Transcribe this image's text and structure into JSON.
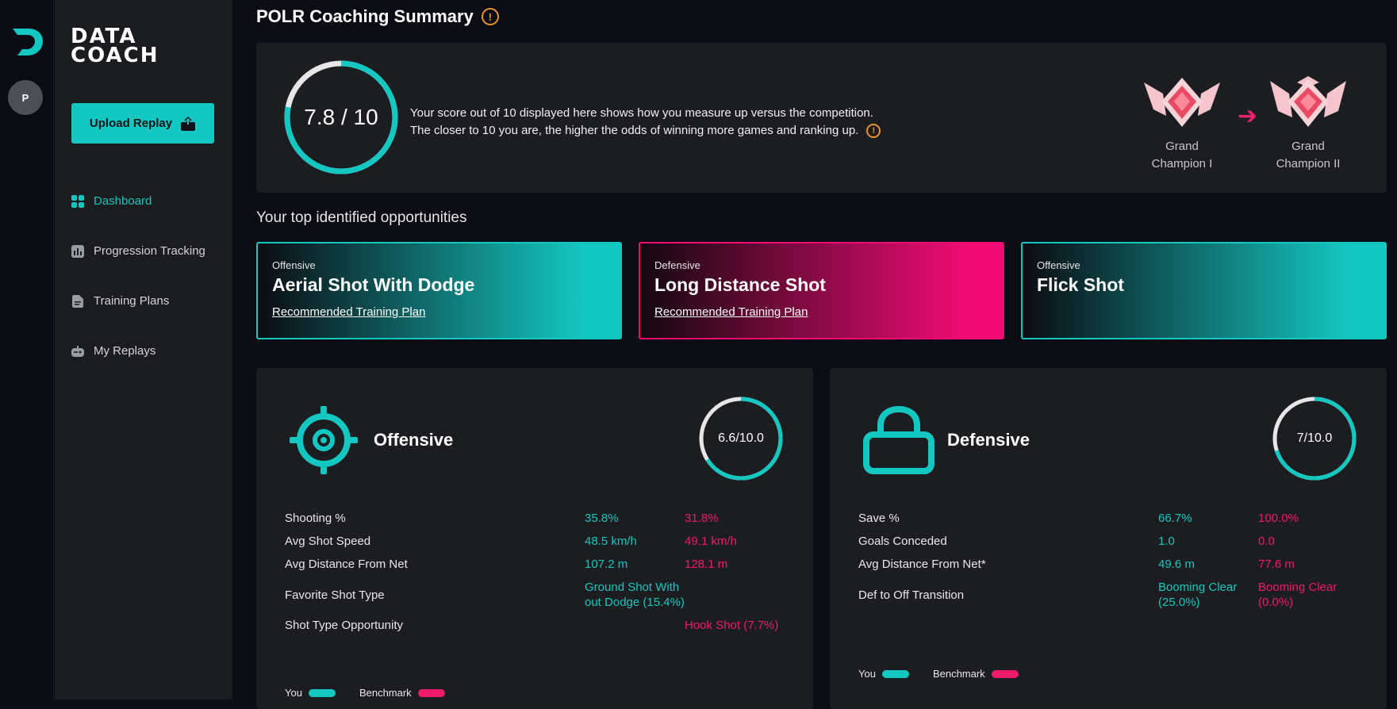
{
  "app": {
    "brand_line1": "DATA",
    "brand_line2": "COACH",
    "avatar_initial": "P"
  },
  "sidebar": {
    "upload_label": "Upload Replay",
    "items": [
      {
        "label": "Dashboard",
        "icon": "grid-icon",
        "active": true
      },
      {
        "label": "Progression Tracking",
        "icon": "bar-chart-icon",
        "active": false
      },
      {
        "label": "Training Plans",
        "icon": "document-icon",
        "active": false
      },
      {
        "label": "My Replays",
        "icon": "controller-icon",
        "active": false
      }
    ]
  },
  "summary": {
    "title": "POLR Coaching Summary",
    "score_text": "7.8 / 10",
    "score_value": 7.8,
    "score_max": 10,
    "desc_line1": "Your score out of 10 displayed here shows how you measure up versus the competition.",
    "desc_line2": "The closer to 10 you are, the higher the odds of winning more games and ranking up.",
    "rank_current_line1": "Grand",
    "rank_current_line2": "Champion I",
    "rank_next_line1": "Grand",
    "rank_next_line2": "Champion II",
    "arrow": "➔"
  },
  "opportunities": {
    "title": "Your top identified opportunities",
    "cards": [
      {
        "category": "Offensive",
        "name": "Aerial Shot With Dodge",
        "link": "Recommended Training Plan",
        "style": "teal"
      },
      {
        "category": "Defensive",
        "name": "Long Distance Shot",
        "link": "Recommended Training Plan",
        "style": "pink"
      },
      {
        "category": "Offensive",
        "name": "Flick Shot",
        "link": "",
        "style": "teal"
      }
    ]
  },
  "offensive": {
    "title": "Offensive",
    "score_text": "6.6/10.0",
    "score_value": 6.6,
    "score_max": 10,
    "rows": [
      {
        "label": "Shooting %",
        "you": "35.8%",
        "bench": "31.8%"
      },
      {
        "label": "Avg Shot Speed",
        "you": "48.5 km/h",
        "bench": "49.1 km/h"
      },
      {
        "label": "Avg Distance From Net",
        "you": "107.2 m",
        "bench": "128.1 m"
      },
      {
        "label": "Favorite Shot Type",
        "you": "Ground Shot With out Dodge (15.4%)",
        "bench": ""
      },
      {
        "label": "Shot Type Opportunity",
        "you": "",
        "bench": "Hook Shot (7.7%)"
      }
    ],
    "legend_you": "You",
    "legend_bench": "Benchmark"
  },
  "defensive": {
    "title": "Defensive",
    "score_text": "7/10.0",
    "score_value": 7,
    "score_max": 10,
    "rows": [
      {
        "label": "Save %",
        "you": "66.7%",
        "bench": "100.0%"
      },
      {
        "label": "Goals Conceded",
        "you": "1.0",
        "bench": "0.0"
      },
      {
        "label": "Avg Distance From Net*",
        "you": "49.6 m",
        "bench": "77.6 m"
      },
      {
        "label": "Def to Off Transition",
        "you": "Booming Clear (25.0%)",
        "bench": "Booming Clear (0.0%)"
      }
    ],
    "legend_you": "You",
    "legend_bench": "Benchmark"
  },
  "colors": {
    "accent": "#14c7c1",
    "benchmark": "#ee1b6c",
    "warning": "#e8932c"
  }
}
